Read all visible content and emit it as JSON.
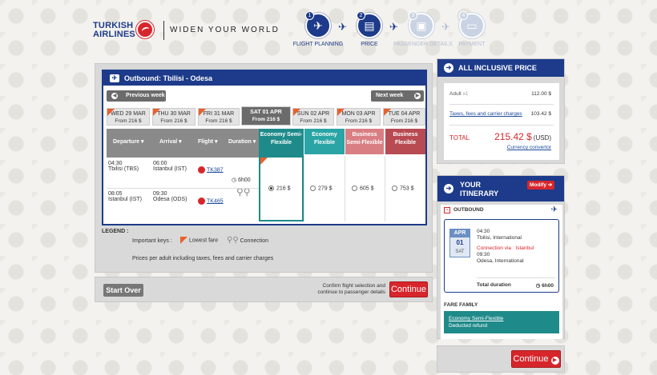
{
  "brand": {
    "name_line1": "TURKISH",
    "name_line2": "AIRLINES",
    "slogan": "WIDEN YOUR WORLD"
  },
  "steps": [
    {
      "num": "1",
      "label": "FLIGHT PLANNING",
      "icon": "globe-plane-icon",
      "active": true
    },
    {
      "num": "2",
      "label": "PRICE",
      "icon": "ticket-icon",
      "active": true
    },
    {
      "num": "3",
      "label": "PASSENGER DETAILS",
      "icon": "passenger-card-icon",
      "active": false
    },
    {
      "num": "4",
      "label": "PAYMENT",
      "icon": "credit-card-icon",
      "active": false
    }
  ],
  "outbound": {
    "title": "Outbound: Tbilisi - Odesa",
    "prev_week": "Previous week",
    "next_week": "Next week",
    "dates": [
      {
        "day": "WED 29 MAR",
        "price": "From 216 $",
        "lowest": true
      },
      {
        "day": "THU 30 MAR",
        "price": "From 216 $",
        "lowest": true
      },
      {
        "day": "FRI 31 MAR",
        "price": "From 216 $",
        "lowest": true
      },
      {
        "day": "SAT 01 APR",
        "price": "From 216 $",
        "lowest": false,
        "selected": true
      },
      {
        "day": "SUN 02 APR",
        "price": "From 216 $",
        "lowest": true
      },
      {
        "day": "MON 03 APR",
        "price": "From 216 $",
        "lowest": true
      },
      {
        "day": "TUE 04 APR",
        "price": "From 216 $",
        "lowest": true
      }
    ],
    "columns": {
      "departure": "Departure",
      "arrival": "Arrival",
      "flight": "Flight",
      "duration": "Duration"
    },
    "fares": [
      {
        "name": "Economy Semi-Flexible",
        "price": "216 $",
        "color": "#1f8a8a",
        "selected": true
      },
      {
        "name": "Economy Flexible",
        "price": "279 $",
        "color": "#2aa4a4"
      },
      {
        "name": "Business Semi-Flexible",
        "price": "605 $",
        "color": "#d97f84"
      },
      {
        "name": "Business Flexible",
        "price": "753 $",
        "color": "#b84a52"
      }
    ],
    "legs": [
      {
        "dep_time": "04:30",
        "dep_city": "Tbilisi (TBS)",
        "arr_time": "06:00",
        "arr_city": "Istanbul (IST)",
        "flight": "TK387"
      },
      {
        "dep_time": "08:05",
        "dep_city": "Istanbul (IST)",
        "arr_time": "09:30",
        "arr_city": "Odesa (ODS)",
        "flight": "TK465"
      }
    ],
    "duration": "6h00"
  },
  "legend": {
    "title": "LEGEND :",
    "keys_label": "Important keys :",
    "lowest_fare": "Lowest fare",
    "connection": "Connection",
    "note": "Prices per adult including taxes, fees and carrier charges"
  },
  "actions": {
    "start_over": "Start Over",
    "confirm_text_line1": "Confirm flight selection and",
    "confirm_text_line2": "continue to passenger details",
    "continue": "Continue"
  },
  "price_panel": {
    "title": "ALL INCLUSIVE PRICE",
    "adult_label": "Adult",
    "adult_count": "x1",
    "adult_price": "112.00 $",
    "taxes_label": "Taxes, fees and carrier charges",
    "taxes_price": "103.42 $",
    "total_label": "TOTAL",
    "total_amount": "215.42 $",
    "total_currency": "(USD)",
    "currency_converter": "Currency convertor"
  },
  "itinerary": {
    "title_line1": "YOUR",
    "title_line2": "ITINERARY",
    "modify": "Modify",
    "outbound_label": "OUTBOUND",
    "month": "APR",
    "day": "01",
    "weekday": "SAT",
    "dep_time": "04:30",
    "dep_city": "Tbilisi, International",
    "connection": "Connection via : Istanbul",
    "arr_time": "09:30",
    "arr_city": "Odesa, International",
    "total_duration_label": "Total duration",
    "total_duration": "6h00",
    "fare_family_label": "FARE FAMILY",
    "fare_name": "Economy Semi-Flexible",
    "fare_note": "Deducted refund",
    "continue": "Continue"
  }
}
